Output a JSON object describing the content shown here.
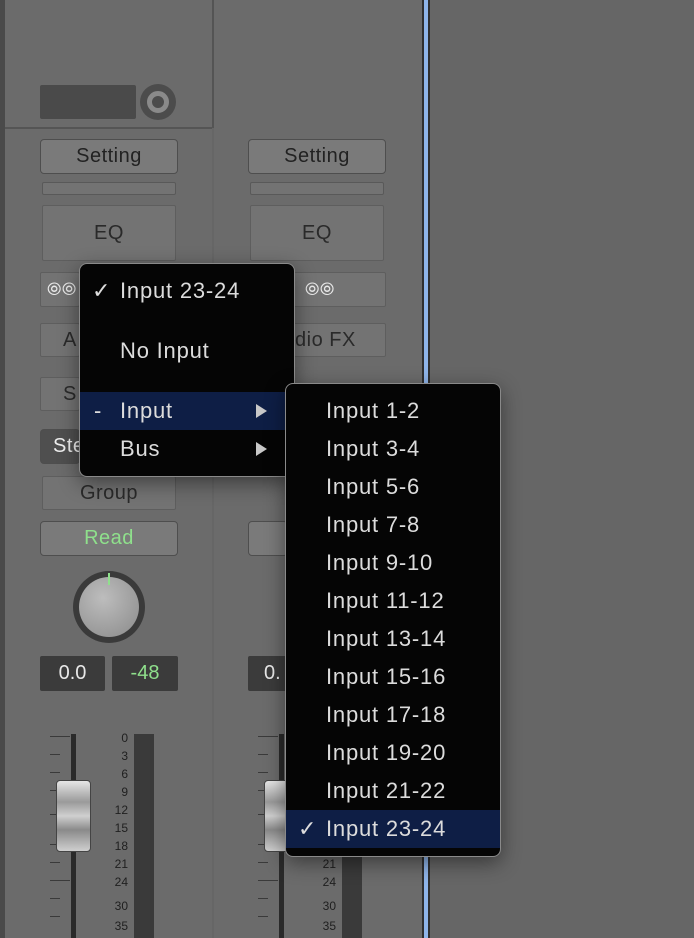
{
  "strip1": {
    "setting_label": "Setting",
    "eq_label": "EQ",
    "audio_fx_partial": "A",
    "send_partial": "S",
    "stereo_partial": "Ste",
    "group_label": "Group",
    "automation_label": "Read",
    "volume_value": "0.0",
    "peak_value": "-48"
  },
  "strip2": {
    "setting_label": "Setting",
    "eq_label": "EQ",
    "audio_fx_partial": "dio FX",
    "volume_partial": "0."
  },
  "meter_scale": [
    "0",
    "3",
    "6",
    "9",
    "12",
    "15",
    "18",
    "21",
    "24",
    "30",
    "35"
  ],
  "meter_scale2": [
    "21",
    "24",
    "30",
    "35"
  ],
  "input_menu": {
    "current": "Input 23-24",
    "check": "✓",
    "no_input": "No Input",
    "dash": "-",
    "input_label": "Input",
    "bus_label": "Bus"
  },
  "input_submenu": {
    "items": [
      "Input 1-2",
      "Input 3-4",
      "Input 5-6",
      "Input 7-8",
      "Input 9-10",
      "Input 11-12",
      "Input 13-14",
      "Input 15-16",
      "Input 17-18",
      "Input 19-20",
      "Input 21-22",
      "Input 23-24"
    ],
    "selected_index": 11,
    "check": "✓"
  },
  "colors": {
    "background": "#666666",
    "menu_bg": "#050505",
    "selection": "#0e1e45",
    "green_text": "#8fe08c",
    "divider_blue": "#8fb5ea"
  }
}
